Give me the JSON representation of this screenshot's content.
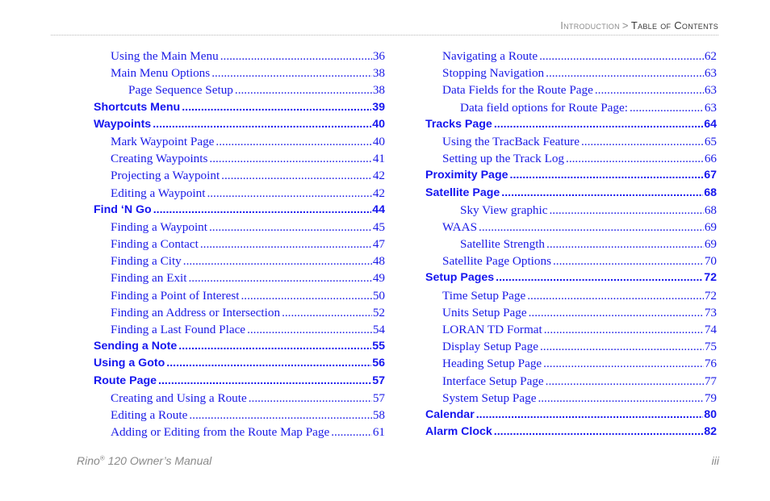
{
  "header": {
    "section": "Introduction",
    "separator": ">",
    "current": "Table of Contents"
  },
  "toc": {
    "left": [
      {
        "level": 2,
        "title": "Using the Main Menu",
        "page": "36"
      },
      {
        "level": 2,
        "title": "Main Menu Options",
        "page": "38"
      },
      {
        "level": 3,
        "title": "Page Sequence Setup",
        "page": "38"
      },
      {
        "level": 1,
        "title": "Shortcuts Menu",
        "page": "39"
      },
      {
        "level": 1,
        "title": "Waypoints",
        "page": "40"
      },
      {
        "level": 2,
        "title": "Mark Waypoint Page",
        "page": "40"
      },
      {
        "level": 2,
        "title": "Creating Waypoints",
        "page": "41"
      },
      {
        "level": 2,
        "title": "Projecting a Waypoint",
        "page": "42"
      },
      {
        "level": 2,
        "title": "Editing a Waypoint",
        "page": "42"
      },
      {
        "level": 1,
        "title": "Find ‘N Go",
        "page": "44"
      },
      {
        "level": 2,
        "title": "Finding a Waypoint",
        "page": "45"
      },
      {
        "level": 2,
        "title": "Finding a Contact",
        "page": "47"
      },
      {
        "level": 2,
        "title": "Finding a City",
        "page": "48"
      },
      {
        "level": 2,
        "title": "Finding an Exit",
        "page": "49"
      },
      {
        "level": 2,
        "title": "Finding a Point of Interest",
        "page": "50"
      },
      {
        "level": 2,
        "title": "Finding an Address or Intersection",
        "page": "52"
      },
      {
        "level": 2,
        "title": "Finding a Last Found Place",
        "page": "54"
      },
      {
        "level": 1,
        "title": "Sending a Note",
        "page": "55"
      },
      {
        "level": 1,
        "title": "Using a Goto",
        "page": "56"
      },
      {
        "level": 1,
        "title": "Route Page",
        "page": "57"
      },
      {
        "level": 2,
        "title": "Creating and Using a Route",
        "page": "57"
      },
      {
        "level": 2,
        "title": "Editing a Route",
        "page": "58"
      },
      {
        "level": 2,
        "title": "Adding or Editing from the Route Map Page",
        "page": "61"
      }
    ],
    "right": [
      {
        "level": 2,
        "title": "Navigating a Route",
        "page": "62"
      },
      {
        "level": 2,
        "title": "Stopping Navigation",
        "page": "63"
      },
      {
        "level": 2,
        "title": "Data Fields for the Route Page",
        "page": "63"
      },
      {
        "level": 3,
        "title": "Data field options for Route Page:",
        "page": "63"
      },
      {
        "level": 1,
        "title": "Tracks Page",
        "page": "64"
      },
      {
        "level": 2,
        "title": "Using the TracBack Feature",
        "page": "65"
      },
      {
        "level": 2,
        "title": "Setting up the Track Log",
        "page": "66"
      },
      {
        "level": 1,
        "title": "Proximity Page",
        "page": "67"
      },
      {
        "level": 1,
        "title": "Satellite Page",
        "page": "68"
      },
      {
        "level": 3,
        "title": "Sky View graphic",
        "page": "68"
      },
      {
        "level": 2,
        "title": "WAAS",
        "page": "69"
      },
      {
        "level": 3,
        "title": "Satellite Strength",
        "page": "69"
      },
      {
        "level": 2,
        "title": "Satellite Page Options",
        "page": "70"
      },
      {
        "level": 1,
        "title": "Setup Pages",
        "page": "72"
      },
      {
        "level": 2,
        "title": "Time Setup Page",
        "page": "72"
      },
      {
        "level": 2,
        "title": "Units Setup Page",
        "page": "73"
      },
      {
        "level": 2,
        "title": "LORAN TD Format",
        "page": "74"
      },
      {
        "level": 2,
        "title": "Display Setup Page",
        "page": "75"
      },
      {
        "level": 2,
        "title": "Heading Setup Page",
        "page": "76"
      },
      {
        "level": 2,
        "title": "Interface Setup Page",
        "page": "77"
      },
      {
        "level": 2,
        "title": "System Setup Page",
        "page": "79"
      },
      {
        "level": 1,
        "title": "Calendar",
        "page": "80"
      },
      {
        "level": 1,
        "title": "Alarm Clock",
        "page": "82"
      }
    ]
  },
  "footer": {
    "product": "Rino",
    "registered_mark": "®",
    "manual_title": " 120 Owner’s Manual",
    "page_number": "iii"
  }
}
